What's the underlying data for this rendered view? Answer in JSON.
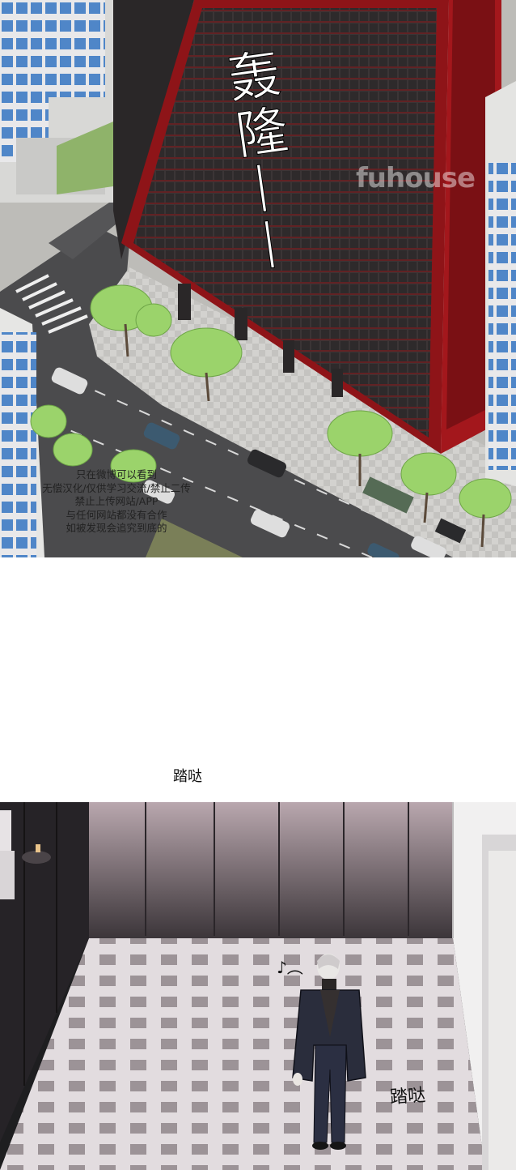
{
  "panels": {
    "city": {
      "sfx_main": "轰隆——",
      "watermark": "fuhouse",
      "notice_lines": [
        "只在微博可以看到",
        "无偿汉化/仅供学习交流/禁止二传",
        "禁止上传网站/APP",
        "与任何网站都没有合作",
        "如被发现会追究到底的"
      ]
    },
    "gap": {
      "sfx_step": "踏哒"
    },
    "hall": {
      "sfx_hum": "♪︵",
      "sfx_step": "踏哒"
    }
  },
  "colors": {
    "building_red": "#8e1418",
    "window_grid": "#3b3536",
    "road": "#4b4b4d",
    "tree_green": "#9bd36b",
    "floor_tile": "#d7d0d3",
    "wall_dark": "#262327",
    "coat": "#2a2d3c"
  },
  "icons": {
    "music_note": "music-note-icon"
  }
}
